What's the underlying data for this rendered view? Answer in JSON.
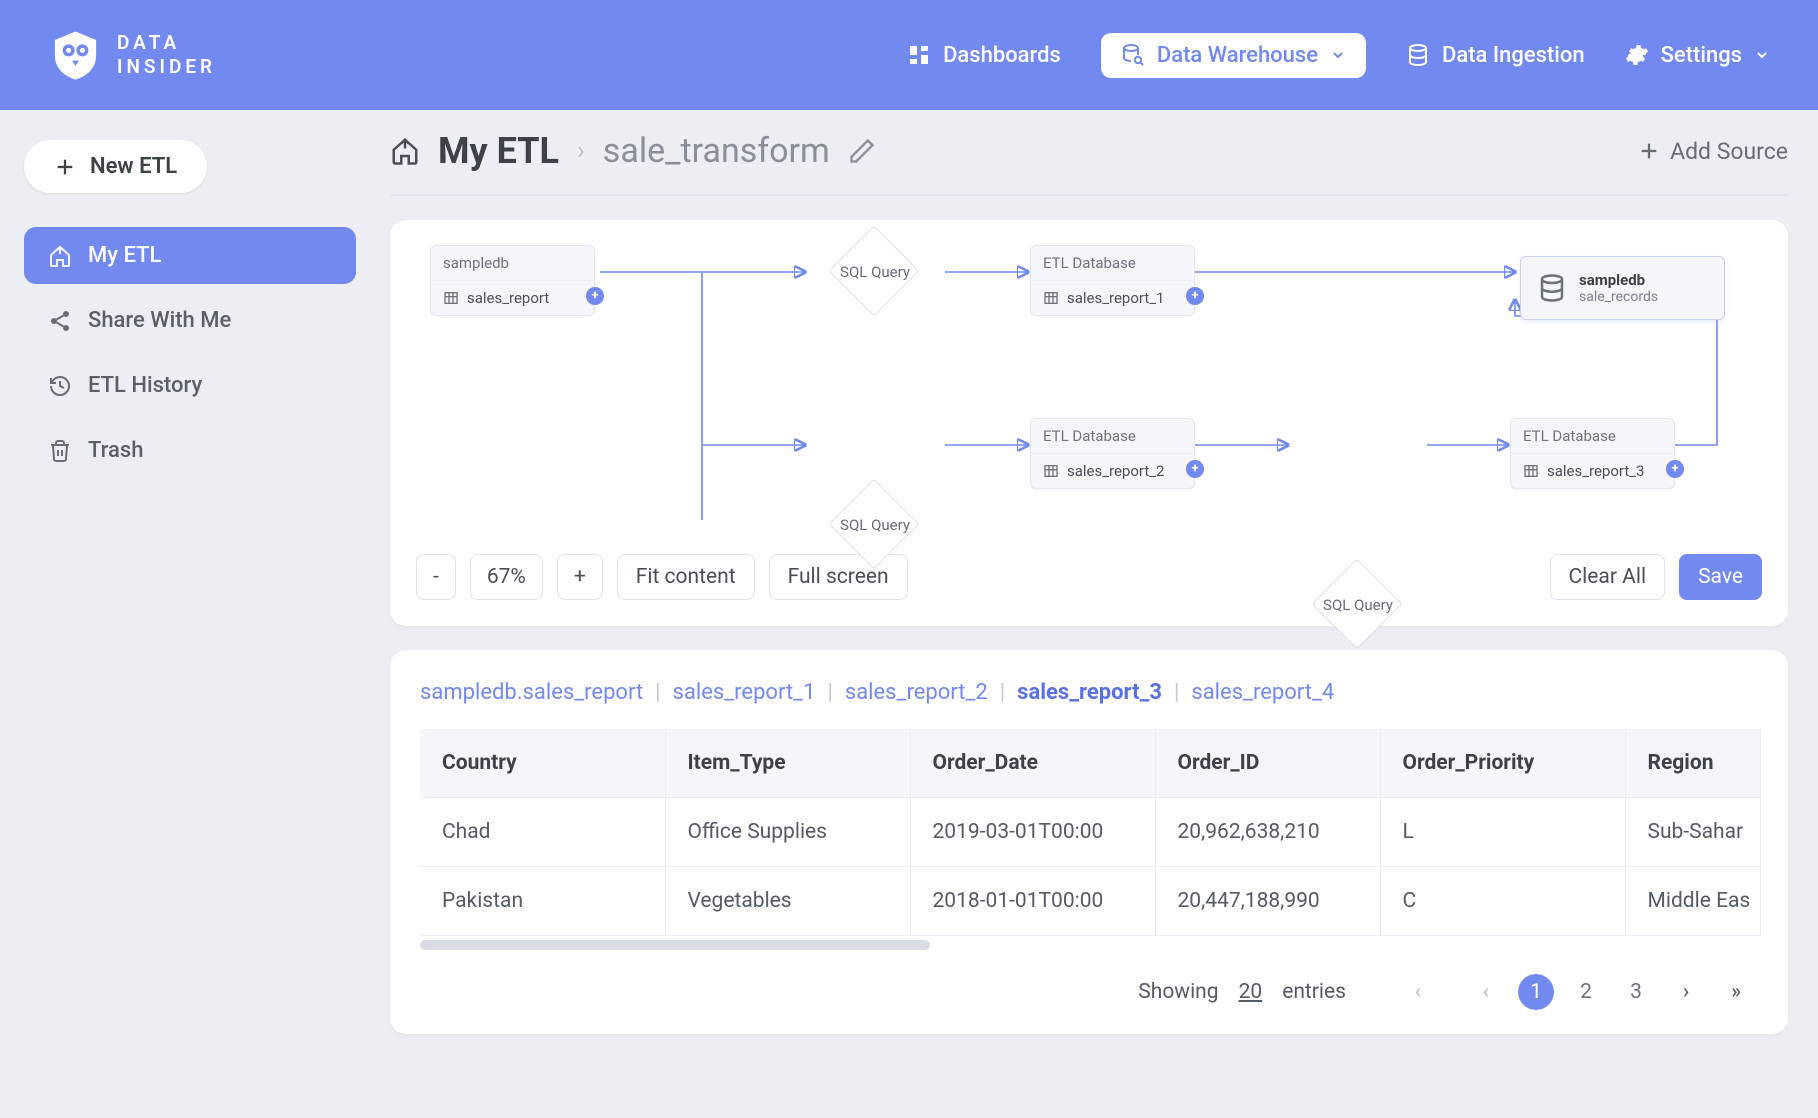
{
  "brand": {
    "line1": "DATA",
    "line2": "INSIDER"
  },
  "nav": {
    "dashboards": "Dashboards",
    "warehouse": "Data Warehouse",
    "ingestion": "Data Ingestion",
    "settings": "Settings"
  },
  "sidebar": {
    "new_etl": "New ETL",
    "items": [
      {
        "label": "My ETL",
        "icon": "house-upload"
      },
      {
        "label": "Share With Me",
        "icon": "share-nodes"
      },
      {
        "label": "ETL History",
        "icon": "history"
      },
      {
        "label": "Trash",
        "icon": "trash"
      }
    ]
  },
  "breadcrumb": {
    "root": "My ETL",
    "current": "sale_transform",
    "add_source": "Add Source"
  },
  "canvas": {
    "source": {
      "top": "sampledb",
      "bot": "sales_report"
    },
    "q1": "SQL Query",
    "db1": {
      "top": "ETL Database",
      "bot": "sales_report_1"
    },
    "q2": "SQL Query",
    "db2": {
      "top": "ETL Database",
      "bot": "sales_report_2"
    },
    "q3": "SQL Query",
    "db3": {
      "top": "ETL Database",
      "bot": "sales_report_3"
    },
    "result": {
      "title": "sampledb",
      "sub": "sale_records"
    },
    "toolbar": {
      "zoom_minus": "-",
      "zoom_val": "67%",
      "zoom_plus": "+",
      "fit": "Fit content",
      "full": "Full screen",
      "clear": "Clear All",
      "save": "Save"
    }
  },
  "tabs": [
    "sampledb.sales_report",
    "sales_report_1",
    "sales_report_2",
    "sales_report_3",
    "sales_report_4"
  ],
  "active_tab_index": 3,
  "table": {
    "headers": [
      "Country",
      "Item_Type",
      "Order_Date",
      "Order_ID",
      "Order_Priority",
      "Region"
    ],
    "rows": [
      [
        "Chad",
        "Office Supplies",
        "2019-03-01T00:00",
        "20,962,638,210",
        "L",
        "Sub-Sahar"
      ],
      [
        "Pakistan",
        "Vegetables",
        "2018-01-01T00:00",
        "20,447,188,990",
        "C",
        "Middle Eas"
      ]
    ]
  },
  "pagination": {
    "showing_prefix": "Showing",
    "count": "20",
    "entries_label": "entries",
    "pages": [
      "1",
      "2",
      "3"
    ]
  }
}
